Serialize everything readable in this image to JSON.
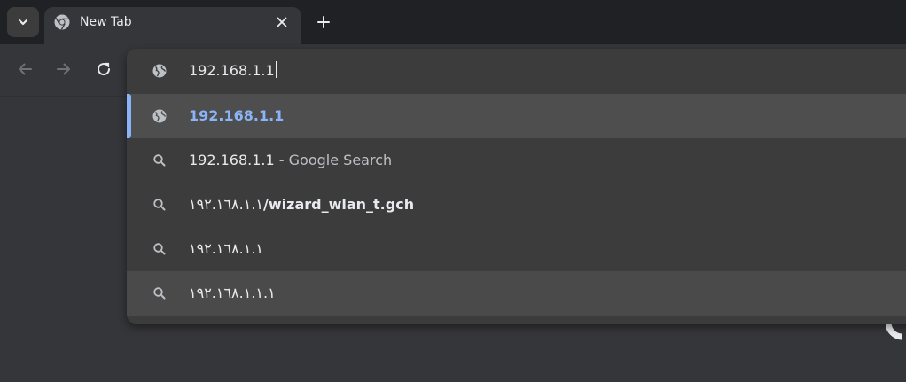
{
  "tab": {
    "title": "New Tab",
    "close_icon": "close-icon",
    "favicon": "chrome-icon"
  },
  "tabstrip": {
    "tab_search_icon": "chevron-down-icon",
    "new_tab_icon": "plus-icon"
  },
  "toolbar": {
    "back_icon": "back-arrow-icon",
    "forward_icon": "forward-arrow-icon",
    "reload_icon": "reload-icon"
  },
  "omnibox": {
    "input_value": "192.168.1.1",
    "input_icon": "globe-icon",
    "suggestions": [
      {
        "icon": "globe-icon",
        "text": "192.168.1.1",
        "type": "url"
      },
      {
        "icon": "search-icon",
        "text": "192.168.1.1",
        "suffix": " - Google Search",
        "type": "search"
      },
      {
        "icon": "search-icon",
        "text": "١٩٢.١٦٨.١.١",
        "bold_suffix": "/wizard_wlan_t.gch",
        "type": "search"
      },
      {
        "icon": "search-icon",
        "text": "١٩٢.١٦٨.١.١",
        "type": "search"
      },
      {
        "icon": "search-icon",
        "text": "١٩٢.١٦٨.١.١.١",
        "type": "search"
      }
    ]
  },
  "colors": {
    "accent": "#8ab4f8",
    "frame": "#202124",
    "toolbar": "#35363a",
    "popup": "#3c3c3c",
    "selected_row": "#4e4e4e"
  }
}
